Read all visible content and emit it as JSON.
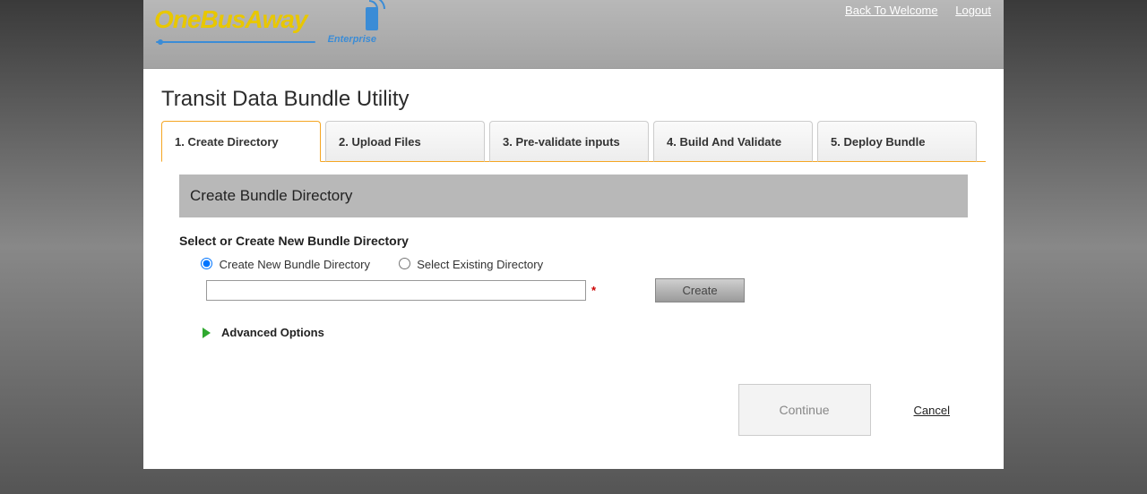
{
  "header": {
    "logo_one": "One",
    "logo_bus": "Bus",
    "logo_away": "Away",
    "logo_enterprise": "Enterprise",
    "links": {
      "back": "Back To Welcome",
      "logout": "Logout"
    }
  },
  "page_title": "Transit Data Bundle Utility",
  "tabs": [
    {
      "label": "1. Create Directory",
      "active": true
    },
    {
      "label": "2. Upload Files",
      "active": false
    },
    {
      "label": "3. Pre-validate inputs",
      "active": false
    },
    {
      "label": "4. Build And Validate",
      "active": false
    },
    {
      "label": "5. Deploy Bundle",
      "active": false
    }
  ],
  "section_heading": "Create Bundle Directory",
  "subheading": "Select or Create New Bundle Directory",
  "radios": {
    "create": "Create New Bundle Directory",
    "select": "Select Existing Directory"
  },
  "directory_value": "",
  "required_mark": "*",
  "create_button": "Create",
  "advanced_label": "Advanced Options",
  "continue_button": "Continue",
  "cancel_link": "Cancel"
}
